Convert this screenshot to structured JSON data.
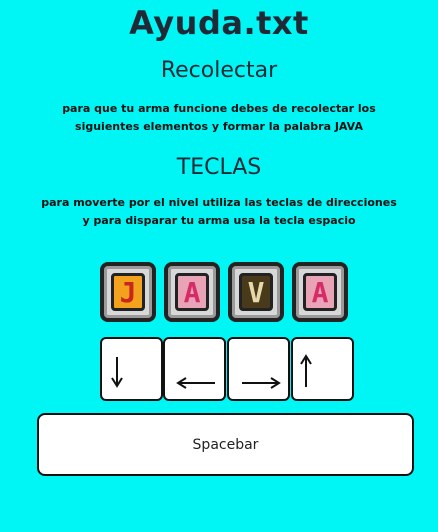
{
  "title": "Ayuda.txt",
  "collect": {
    "heading": "Recolectar",
    "text": "para que tu arma funcione debes de recolectar los siguientes elementos y formar la palabra JAVA"
  },
  "keys_section": {
    "heading": "TECLAS",
    "text": "para moverte por el nivel utiliza las teclas de direcciones y para disparar tu arma usa la tecla espacio"
  },
  "tiles": [
    {
      "letter": "J",
      "fill": "#f2a21c",
      "ink": "#c8261e"
    },
    {
      "letter": "A",
      "fill": "#e8a3b6",
      "ink": "#d62b66"
    },
    {
      "letter": "V",
      "fill": "#4a3a1c",
      "ink": "#e9d9a8"
    },
    {
      "letter": "A",
      "fill": "#e8a3b6",
      "ink": "#d62b66"
    }
  ],
  "arrow_keys": [
    "arrow-down-icon",
    "arrow-left-icon",
    "arrow-right-icon",
    "arrow-up-icon"
  ],
  "spacebar_label": "Spacebar",
  "colors": {
    "background": "#00f5f5",
    "text": "#1f2a36"
  }
}
